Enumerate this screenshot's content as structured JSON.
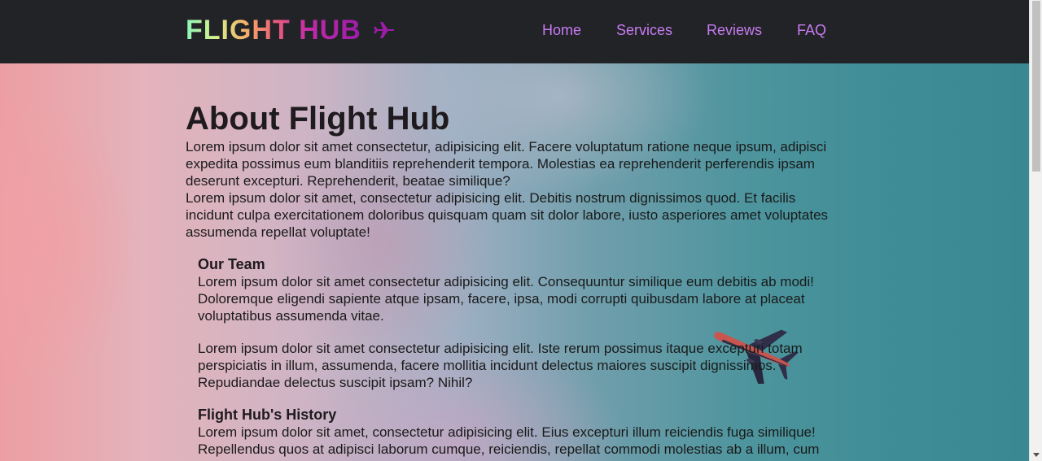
{
  "header": {
    "logo_text": "FLIGHT HUB",
    "logo_icon": "airplane-icon",
    "nav": [
      {
        "label": "Home"
      },
      {
        "label": "Services"
      },
      {
        "label": "Reviews"
      },
      {
        "label": "FAQ"
      }
    ]
  },
  "about": {
    "title": "About Flight Hub",
    "paragraphs": [
      "Lorem ipsum dolor sit amet consectetur, adipisicing elit. Facere voluptatum ratione neque ipsum, adipisci expedita possimus eum blanditiis reprehenderit tempora. Molestias ea reprehenderit perferendis ipsam deserunt excepturi. Reprehenderit, beatae similique?",
      "Lorem ipsum dolor sit amet, consectetur adipisicing elit. Debitis nostrum dignissimos quod. Et facilis incidunt culpa exercitationem doloribus quisquam quam sit dolor labore, iusto asperiores amet voluptates assumenda repellat voluptate!"
    ]
  },
  "team": {
    "title": "Our Team",
    "paragraphs": [
      "Lorem ipsum dolor sit amet consectetur adipisicing elit. Consequuntur similique eum debitis ab modi! Doloremque eligendi sapiente atque ipsam, facere, ipsa, modi corrupti quibusdam labore at placeat voluptatibus assumenda vitae.",
      "Lorem ipsum dolor sit amet consectetur adipisicing elit. Iste rerum possimus itaque excepturi totam perspiciatis in illum, assumenda, facere mollitia incidunt delectus maiores suscipit dignissimos. Repudiandae delectus suscipit ipsam? Nihil?"
    ]
  },
  "history": {
    "title": "Flight Hub's History",
    "paragraphs": [
      "Lorem ipsum dolor sit amet, consectetur adipisicing elit. Eius excepturi illum reiciendis fuga similique! Repellendus quos at adipisci laborum cumque, reiciendis, repellat commodi molestias ab a illum, cum quis animi?"
    ]
  },
  "colors": {
    "nav_background": "#222327",
    "nav_link": "#c77bf2",
    "logo_icon": "#9d1ca9"
  }
}
